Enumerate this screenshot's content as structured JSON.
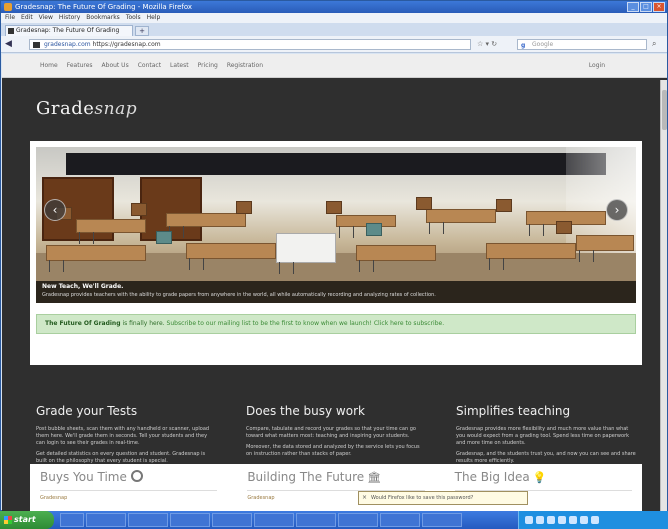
{
  "window": {
    "title": "Gradesnap: The Future Of Grading - Mozilla Firefox"
  },
  "menubar": [
    "File",
    "Edit",
    "View",
    "History",
    "Bookmarks",
    "Tools",
    "Help"
  ],
  "tab": {
    "label": "Gradesnap: The Future Of Grading"
  },
  "newtab_label": "+",
  "addressbar": {
    "host": "gradesnap.com",
    "url": "https://gradesnap.com",
    "search_placeholder": "Google"
  },
  "site_nav": {
    "items": [
      "Home",
      "Features",
      "About Us",
      "Contact",
      "Latest",
      "Pricing",
      "Registration"
    ],
    "login": "Login"
  },
  "logo": {
    "main": "Grade",
    "accent": "snap"
  },
  "carousel": {
    "caption_title": "New Teach, We'll Grade.",
    "caption_text": "Gradesnap provides teachers with the ability to grade papers from anywhere in the world, all while automatically recording and analyzing rates of collection.",
    "prev": "‹",
    "next": "›"
  },
  "alert": {
    "bold": "The Future Of Grading",
    "text": "is finally here.",
    "link": "Subscribe to our mailing list to be the first to know when we launch! Click here to subscribe."
  },
  "features": [
    {
      "title": "Grade your Tests",
      "paragraphs": [
        "Post bubble sheets, scan them with any handheld or scanner, upload them here. We'll grade them in seconds. Tell your students and they can login to see their grades in real-time.",
        "Get detailed statistics on every question and student. Gradesnap is built on the philosophy that every student is special."
      ]
    },
    {
      "title": "Does the busy work",
      "paragraphs": [
        "Compare, tabulate and record your grades so that your time can go toward what matters most: teaching and inspiring your students.",
        "Moreover, the data stored and analyzed by the service lets you focus on instruction rather than stacks of paper."
      ]
    },
    {
      "title": "Simplifies teaching",
      "paragraphs": [
        "Gradesnap provides more flexibility and much more value than what you would expect from a grading tool. Spend less time on paperwork and more time on students.",
        "Gradesnap, and the students trust you, and now you can see and share results more efficiently."
      ]
    }
  ],
  "cards": [
    {
      "title": "Buys You Time",
      "icon": "clock-icon",
      "text": "Gradesnap"
    },
    {
      "title": "Building The Future",
      "icon": "building-icon",
      "text": "Gradesnap"
    },
    {
      "title": "The Big Idea",
      "icon": "lightbulb-icon",
      "text": "Gradesnap"
    }
  ],
  "popup": {
    "text": "Would Firefox like to save this password?"
  },
  "taskbar": {
    "start_label": "start"
  }
}
